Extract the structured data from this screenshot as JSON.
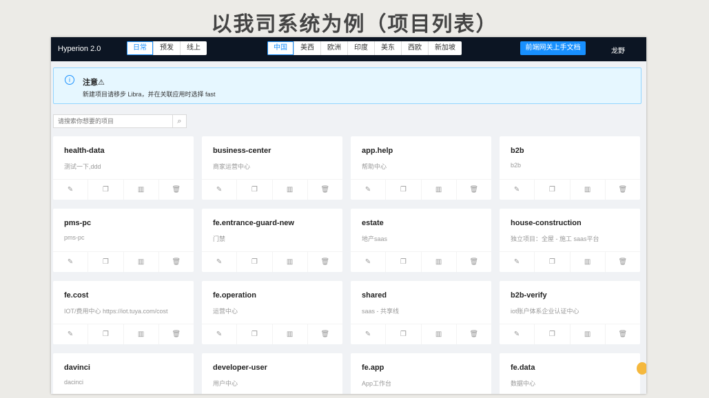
{
  "slide_title": "以我司系统为例（项目列表）",
  "header": {
    "brand": "Hyperion 2.0",
    "envs": [
      "日常",
      "预发",
      "线上"
    ],
    "active_env": 0,
    "regions": [
      "中国",
      "美西",
      "欧洲",
      "印度",
      "美东",
      "西欧",
      "新加坡"
    ],
    "active_region": 0,
    "doc_button": "前端网关上手文档",
    "user": "龙野"
  },
  "alert": {
    "title": "注意⚠",
    "desc": "新建项目请移步 Libra，并在关联应用时选择 fast"
  },
  "search": {
    "placeholder": "请搜索你想要的项目",
    "value": ""
  },
  "actions": [
    "edit-icon",
    "copy-icon",
    "chart-icon",
    "delete-icon"
  ],
  "projects": [
    {
      "name": "health-data",
      "desc": "测试一下,ddd"
    },
    {
      "name": "business-center",
      "desc": "商家运营中心"
    },
    {
      "name": "app.help",
      "desc": "帮助中心"
    },
    {
      "name": "b2b",
      "desc": "b2b"
    },
    {
      "name": "pms-pc",
      "desc": "pms-pc"
    },
    {
      "name": "fe.entrance-guard-new",
      "desc": "门禁"
    },
    {
      "name": "estate",
      "desc": "地产saas"
    },
    {
      "name": "house-construction",
      "desc": "独立项目：全屋 - 施工 saas平台"
    },
    {
      "name": "fe.cost",
      "desc": "IOT/费用中心 https://iot.tuya.com/cost"
    },
    {
      "name": "fe.operation",
      "desc": "运营中心"
    },
    {
      "name": "shared",
      "desc": "saas - 共享线"
    },
    {
      "name": "b2b-verify",
      "desc": "iot账户体系企业认证中心"
    },
    {
      "name": "davinci",
      "desc": "dacinci"
    },
    {
      "name": "developer-user",
      "desc": "用户中心"
    },
    {
      "name": "fe.app",
      "desc": "App工作台"
    },
    {
      "name": "fe.data",
      "desc": "数据中心"
    }
  ]
}
